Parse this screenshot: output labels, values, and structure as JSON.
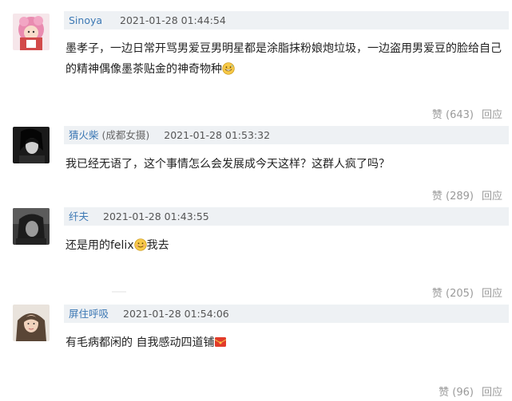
{
  "comments": [
    {
      "username": "Sinoya",
      "tag": "",
      "time": "2021-01-28 01:44:54",
      "content": "墨孝子，一边日常开骂男爱豆男明星都是涂脂抹粉娘炮垃圾，一边盗用男爱豆的脸给自己的精神偶像墨茶贴金的神奇物种",
      "emoji": "grin-sweat-emoji",
      "like_label": "赞",
      "like_count": "(643)",
      "reply_label": "回应",
      "avatar": "pink-hair-anime-avatar"
    },
    {
      "username": "猜火柴",
      "tag": "(成都女摄)",
      "time": "2021-01-28 01:53:32",
      "content": "我已经无语了，这个事情怎么会发展成今天这样？这群人疯了吗？",
      "emoji": "",
      "like_label": "赞",
      "like_count": "(289)",
      "reply_label": "回应",
      "avatar": "black-white-portrait-avatar"
    },
    {
      "username": "纤夫",
      "tag": "",
      "time": "2021-01-28 01:43:55",
      "content_before": "还是用的felix",
      "content_after": "我去",
      "emoji": "smile-emoji",
      "like_label": "赞",
      "like_count": "(205)",
      "reply_label": "回应",
      "avatar": "dark-portrait-avatar"
    },
    {
      "username": "屏住呼吸",
      "tag": "",
      "time": "2021-01-28 01:54:06",
      "content": "有毛病都闲的 自我感动四道铺",
      "emoji": "red-envelope-emoji",
      "like_label": "赞",
      "like_count": "(96)",
      "reply_label": "回应",
      "avatar": "girl-photo-avatar"
    }
  ]
}
